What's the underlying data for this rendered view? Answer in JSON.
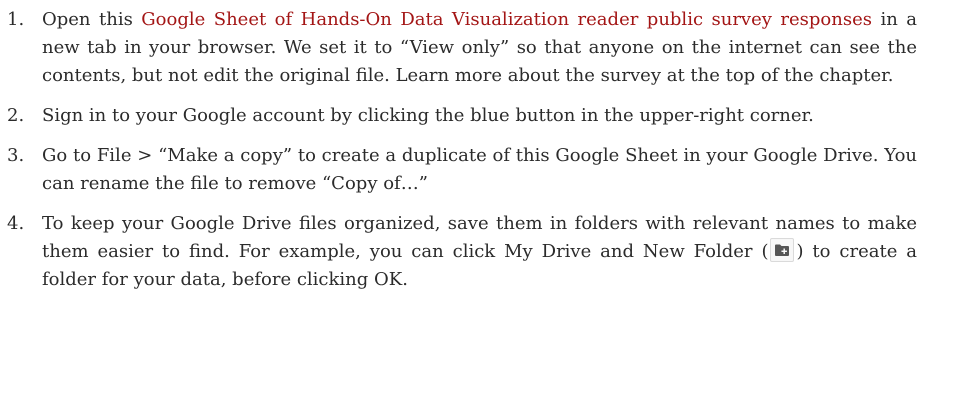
{
  "steps": [
    {
      "num": "1.",
      "link_text": "Google Sheet of Hands-On Data Visualization reader public survey responses",
      "text_before": "Open this ",
      "text_after": " in a new tab in your browser. We set it to “View only” so that anyone on the internet can see the contents, but not edit the original file. Learn more about the survey at the top of the chapter."
    },
    {
      "num": "2.",
      "text": "Sign in to your Google account by clicking the blue button in the upper-right corner."
    },
    {
      "num": "3.",
      "text": "Go to File > “Make a copy” to create a duplicate of this Google Sheet in your Google Drive. You can rename the file to remove “Copy of…”"
    },
    {
      "num": "4.",
      "text_before": "To keep your Google Drive files organized, save them in folders with relevant names to make them easier to find. For example, you can click My Drive and New Folder (",
      "icon": "new-folder-icon",
      "text_after": ") to create a folder for your data, before clicking OK."
    }
  ],
  "colors": {
    "link": "#a31515",
    "text": "#2b2b2b",
    "icon": "#555555"
  }
}
